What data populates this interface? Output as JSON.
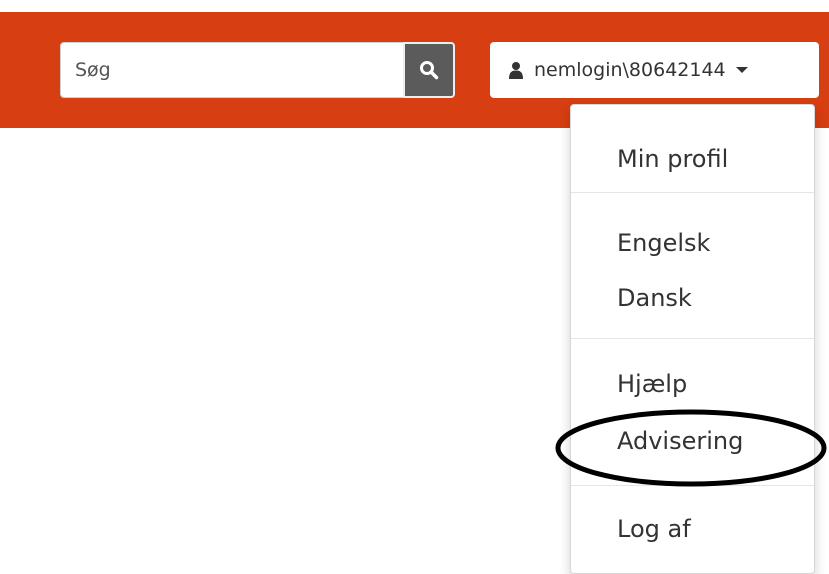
{
  "header": {
    "background_color": "#d73e12",
    "search": {
      "placeholder": "Søg",
      "value": "",
      "button_icon": "search-icon"
    },
    "user_menu": {
      "icon": "user-icon",
      "label": "nemlogin\\80642144",
      "caret_icon": "caret-down-icon"
    }
  },
  "dropdown": {
    "items": [
      {
        "label": "Min profil"
      },
      {
        "label": "Engelsk"
      },
      {
        "label": "Dansk"
      },
      {
        "label": "Hjælp"
      },
      {
        "label": "Advisering",
        "highlighted": true
      },
      {
        "label": "Log af"
      }
    ]
  },
  "annotation": {
    "highlight_color": "#000000"
  }
}
